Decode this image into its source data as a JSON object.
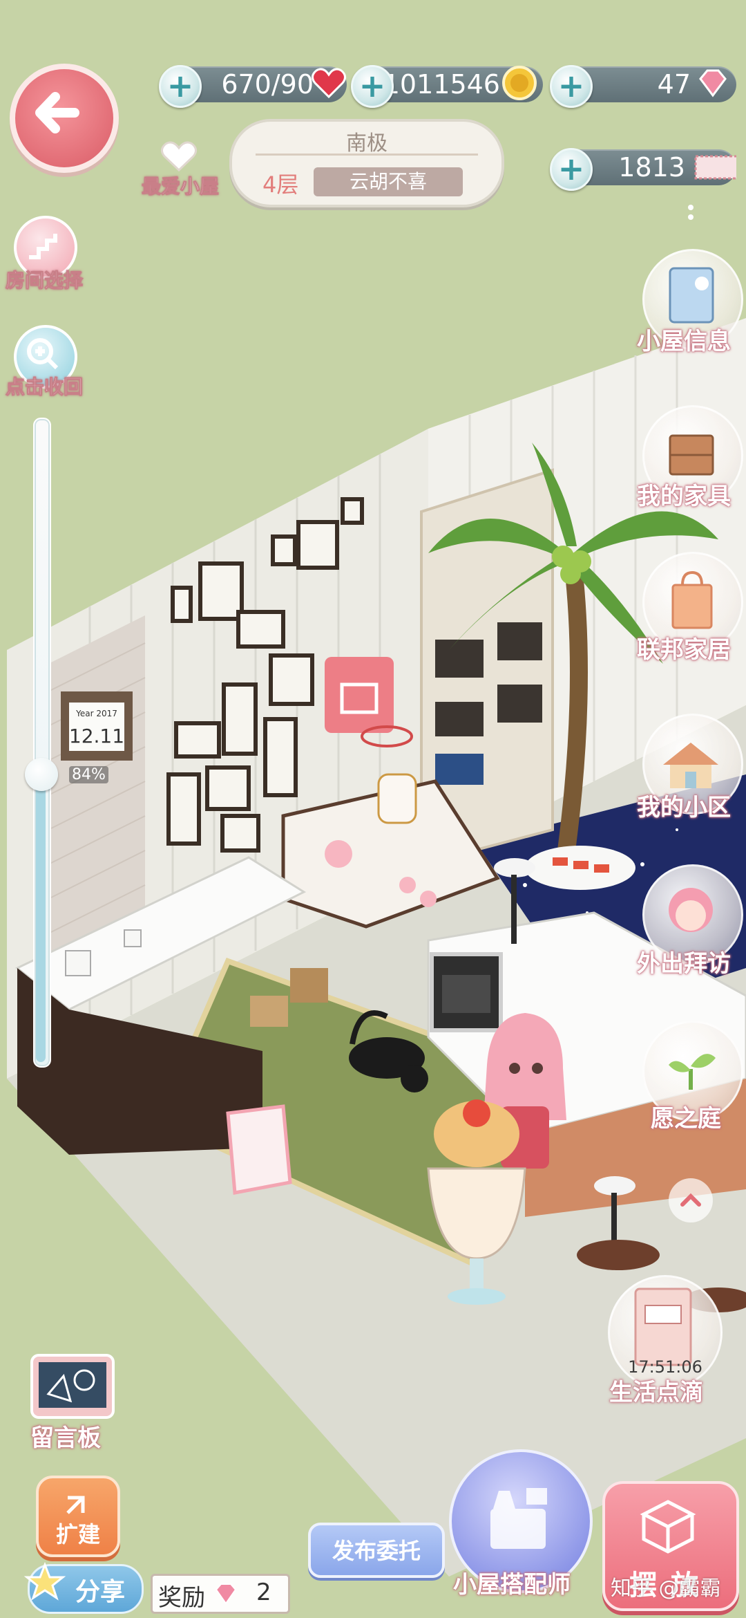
{
  "resources": {
    "stamina": "670/90",
    "coins": "1011546",
    "diamonds": "47",
    "tickets": "1813"
  },
  "room": {
    "favorite_label": "最爱小屋",
    "name": "南极",
    "floor": "4层",
    "owner": "云胡不喜"
  },
  "left_tools": {
    "room_select": "房间选择",
    "zoom": "点击收回",
    "zoom_level": "84%"
  },
  "right_menu": {
    "house_info": "小屋信息",
    "my_furniture": "我的家具",
    "federation_home": "联邦家居",
    "my_community": "我的小区",
    "visit": "外出拜访",
    "wish_garden": "愿之庭",
    "life_moments": "生活点滴",
    "life_moments_time": "17:51:06"
  },
  "bottom": {
    "message_board": "留言板",
    "expand": "扩建",
    "share": "分享",
    "reward_label": "奖励",
    "reward_count": "2",
    "post_commission": "发布委托",
    "stylist": "小屋搭配师",
    "place": "摆放"
  },
  "watermark": "知乎 @霸霸",
  "scene": {
    "calendar_year": "Year 2017",
    "calendar_date": "12.11"
  },
  "colors": {
    "background": "#c6d3a6",
    "accent_pink": "#e26d76",
    "bar": "#6f8086"
  }
}
